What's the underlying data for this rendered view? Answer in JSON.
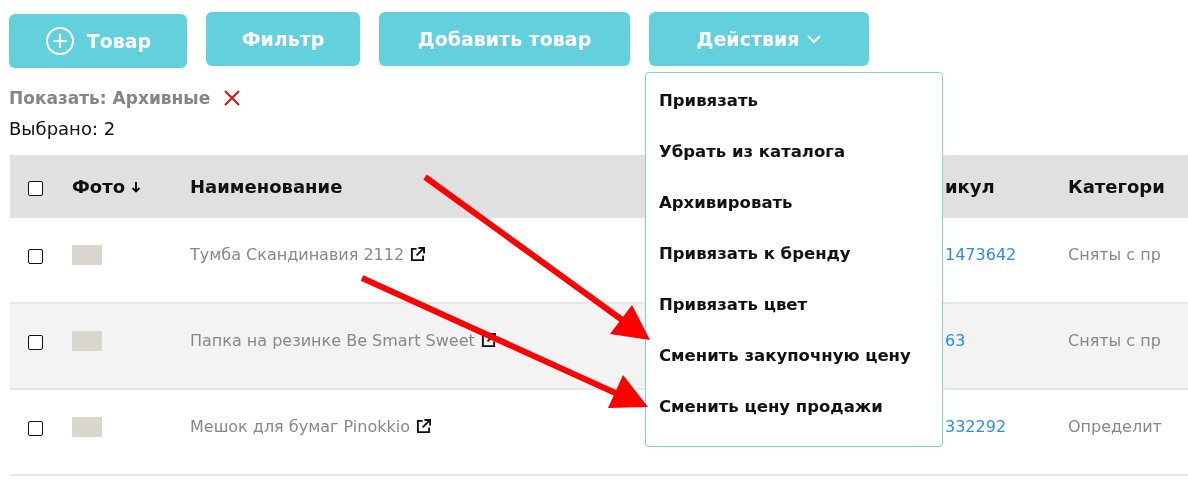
{
  "toolbar": [
    {
      "kind": "add",
      "label": "Товар"
    },
    {
      "kind": "plain",
      "label": "Фильтр"
    },
    {
      "kind": "plain",
      "label": "Добавить товар"
    },
    {
      "kind": "dropdown",
      "label": "Действия"
    }
  ],
  "actions_menu": [
    "Привязать",
    "Убрать из каталога",
    "Архивировать",
    "Привязать к бренду",
    "Привязать цвет",
    "Сменить закупочную цену",
    "Сменить цену продажи"
  ],
  "filter": {
    "label": "Показать: Архивные"
  },
  "selected_count": "Выбрано: 2",
  "table": {
    "header_checked": false,
    "columns": [
      "Фото",
      "Наименование",
      "икул",
      "Категори"
    ],
    "rows": [
      {
        "checked": false,
        "name": "Тумба Скандинавия 2112",
        "article": "1473642",
        "category": "Сняты с пр"
      },
      {
        "checked": false,
        "name": "Папка на резинке Be Smart Sweet",
        "article": "63",
        "category": "Сняты с пр"
      },
      {
        "checked": false,
        "name": "Мешок для бумаг Pinokkio",
        "article": "332292",
        "category": "Определит"
      }
    ]
  }
}
